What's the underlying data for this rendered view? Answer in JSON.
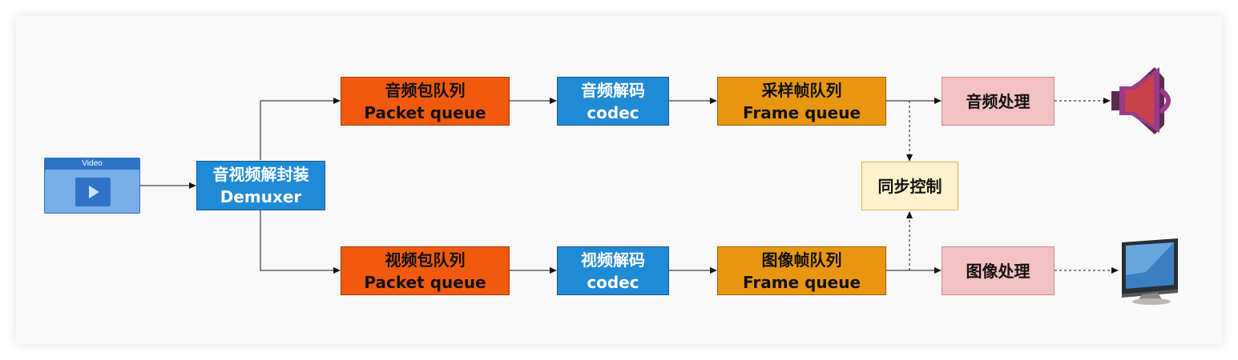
{
  "video": {
    "label": "Video"
  },
  "demuxer": {
    "line1": "音视频解封装",
    "line2": "Demuxer"
  },
  "audio_packet_queue": {
    "line1": "音频包队列",
    "line2": "Packet queue"
  },
  "audio_codec": {
    "line1": "音频解码",
    "line2": "codec"
  },
  "audio_frame_queue": {
    "line1": "采样帧队列",
    "line2": "Frame queue"
  },
  "audio_processing": {
    "label": "音频处理"
  },
  "sync_control": {
    "label": "同步控制"
  },
  "video_packet_queue": {
    "line1": "视频包队列",
    "line2": "Packet queue"
  },
  "video_codec": {
    "line1": "视频解码",
    "line2": "codec"
  },
  "video_frame_queue": {
    "line1": "图像帧队列",
    "line2": "Frame queue"
  },
  "video_processing": {
    "label": "图像处理"
  },
  "icons": {
    "output_audio": "speaker-icon",
    "output_video": "monitor-icon",
    "input": "video-file-icon"
  },
  "colors": {
    "packet_queue": "#f15a0e",
    "codec": "#1f8ad6",
    "frame_queue": "#e8960f",
    "processing": "#f4c1c3",
    "sync": "#fff2cc",
    "speaker": "#c8434b"
  }
}
